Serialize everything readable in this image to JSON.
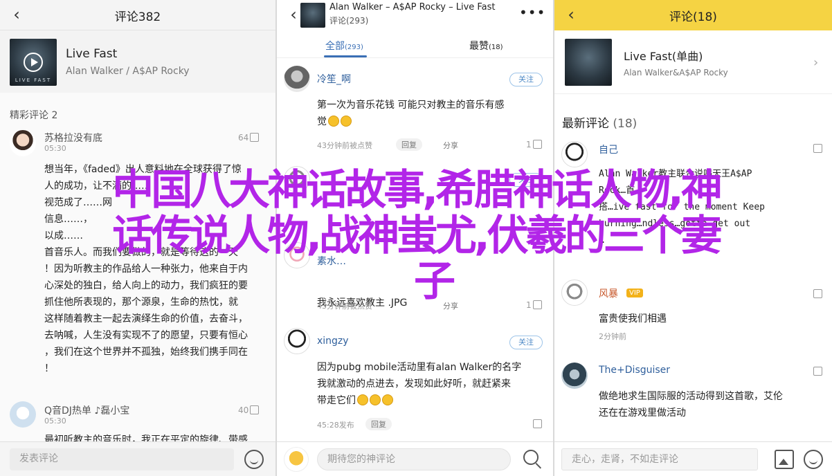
{
  "panel1": {
    "header_title": "评论382",
    "song": "Live Fast",
    "artist": "Alan Walker / A$AP Rocky",
    "cover_caption": "LIVE FAST",
    "section_title": "精彩评论 2",
    "comments": [
      {
        "nick": "苏格拉没有底",
        "time": "05:30",
        "likes": "64",
        "lines": [
          "想当年，《faded》出人意料地在全球获得了惊",
          "人的成功，让不满的……",
          "视范成了……网",
          "信息……，",
          "以成……",
          "首音乐人。而我们要做的，就是等待这的一天",
          "！因为听教主的作品给人一种张力，他来自于内",
          "心深处的独白，给人向上的动力，我们疯狂的要",
          "抓住他所表现的，那个源泉，生命的热忱，就",
          "这样随着教主一起去演绎生命的价值，去奋斗，",
          "去呐喊，人生没有实现不了的愿望，只要有恒心",
          "，我们在这个世界并不孤独，始终我们携手同在",
          "！"
        ]
      },
      {
        "nick": "Q音DJ热单 ♪磊小宝",
        "time": "05:30",
        "likes": "40",
        "lines": [
          "最初听教主的音乐时，我正在平定的旋律、带感"
        ]
      }
    ],
    "input_placeholder": "发表评论"
  },
  "panel2": {
    "header_title": "Alan Walker – A$AP Rocky – Live Fast",
    "header_sub": "评论(293)",
    "tab_all": "全部",
    "tab_all_count": "(293)",
    "tab_hot": "最赞",
    "tab_hot_count": "(18)",
    "follow_label": "关注",
    "reply_label": "回复",
    "share_label": "分享",
    "comments": [
      {
        "nick": "冷笙_啊",
        "text1": "第一次为音乐花钱    可能只对教主的音乐有感",
        "text2": "觉",
        "time": "43分钟前被点赞",
        "likes": "1"
      },
      {
        "nick": "…",
        "text1": "",
        "text2": "",
        "time": "",
        "likes": ""
      },
      {
        "nick": "素水…",
        "text1": "我永远喜欢教主 .JPG",
        "text2": "",
        "time": "43分钟前被点赞",
        "likes": "1"
      },
      {
        "nick": "xingzy",
        "text1": "因为pubg mobile活动里有alan Walker的名字",
        "text2": "我就激动的点进去，发现如此好听，就赶紧来",
        "text3": "带走它们",
        "time": "45:28发布",
        "likes": ""
      }
    ],
    "input_placeholder": "期待您的神评论"
  },
  "panel3": {
    "header_title": "评论(18)",
    "song": "Live Fast(单曲)",
    "artist": "Alan Walker&A$AP Rocky",
    "section_title": "最新评论",
    "section_count": "(18)",
    "comments": [
      {
        "nick": "自己",
        "lines": [
          "Alan Walker教主联合说唱天王A$AP",
          "Rock…首…",
          "搭…ive fast for the moment Keep",
          "burning…ndless…gotta get out",
          "…"
        ]
      },
      {
        "nick": "风暴",
        "lines": [
          "富贵使我们相遇"
        ],
        "time": "2分钟前"
      },
      {
        "nick": "The+Disguiser",
        "lines": [
          "做绝地求生国际服的活动得到这首歌，艾伦",
          "还在在游戏里做活动"
        ]
      }
    ],
    "input_placeholder": "走心，走肾，不如走评论"
  },
  "overlay": {
    "line1": "中国八大神话故事,希腊神话人物,神",
    "line2": "话传说人物,战神蚩尤,伏羲的三个妻",
    "line3": "子"
  }
}
